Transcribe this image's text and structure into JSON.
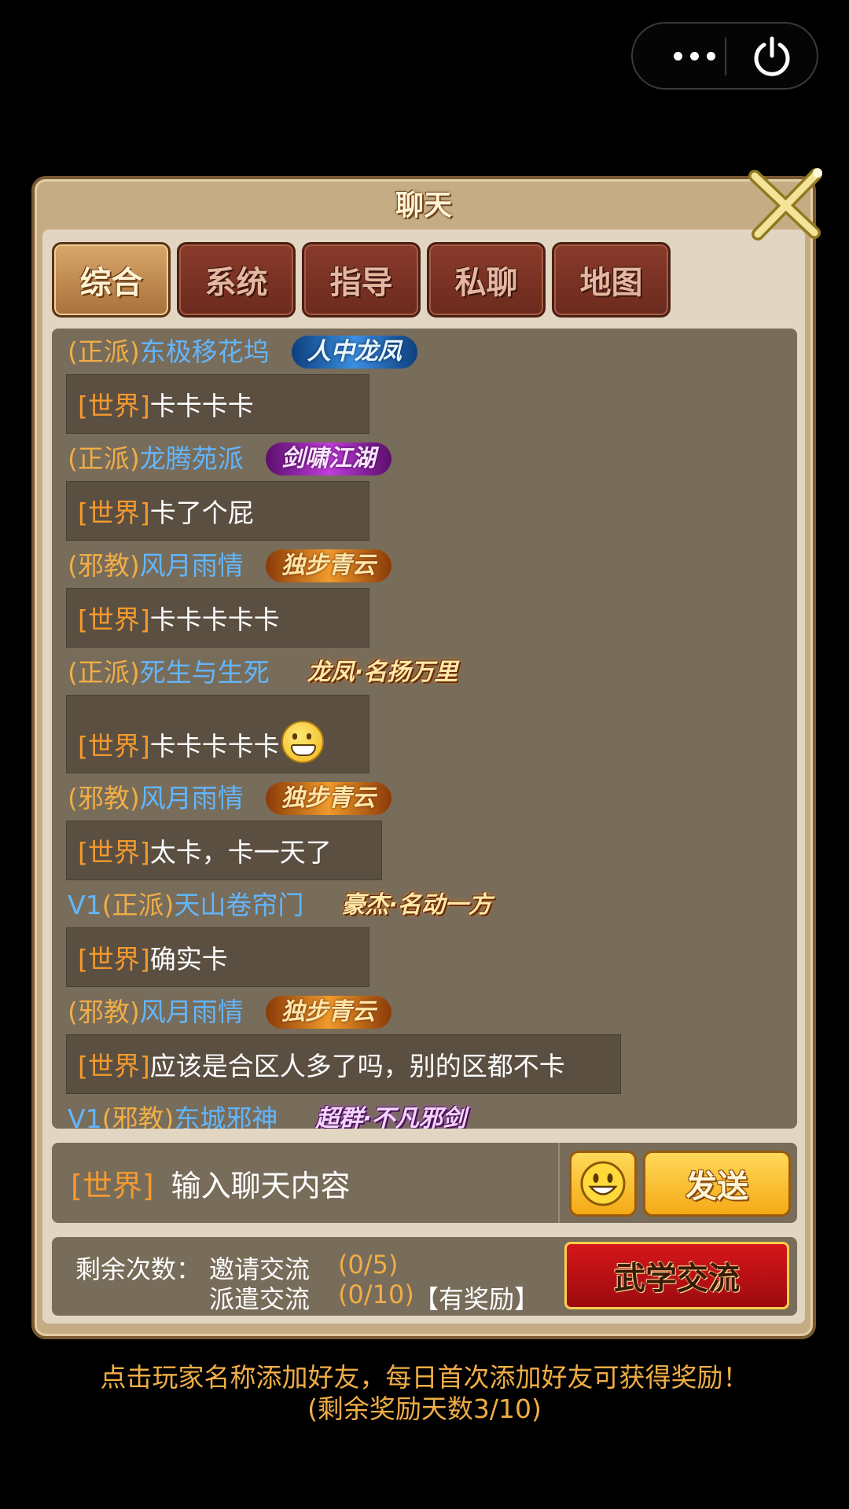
{
  "panel": {
    "title": "聊天"
  },
  "tabs": [
    {
      "label": "综合",
      "active": true
    },
    {
      "label": "系统",
      "active": false
    },
    {
      "label": "指导",
      "active": false
    },
    {
      "label": "私聊",
      "active": false
    },
    {
      "label": "地图",
      "active": false
    }
  ],
  "messages": [
    {
      "prefix": "",
      "sect": "(正派)",
      "name": "东极移花坞",
      "badge": "人中龙凤",
      "channel": "[世界]",
      "text": "卡卡卡卡",
      "emoji": false
    },
    {
      "prefix": "",
      "sect": "(正派)",
      "name": "龙腾苑派",
      "badge": "剑啸江湖",
      "channel": "[世界]",
      "text": "卡了个屁",
      "emoji": false
    },
    {
      "prefix": "",
      "sect": "(邪教)",
      "name": "风月雨情",
      "badge": "独步青云",
      "channel": "[世界]",
      "text": "卡卡卡卡卡",
      "emoji": false
    },
    {
      "prefix": "",
      "sect": "(正派)",
      "name": "死生与生死",
      "badge": "龙凤·名扬万里",
      "channel": "[世界]",
      "text": "卡卡卡卡卡",
      "emoji": true
    },
    {
      "prefix": "",
      "sect": "(邪教)",
      "name": "风月雨情",
      "badge": "独步青云",
      "channel": "[世界]",
      "text": "太卡，卡一天了",
      "emoji": false
    },
    {
      "prefix": "V1",
      "sect": "(正派)",
      "name": "天山卷帘门",
      "badge": "豪杰·名动一方",
      "channel": "[世界]",
      "text": "确实卡",
      "emoji": false
    },
    {
      "prefix": "",
      "sect": "(邪教)",
      "name": "风月雨情",
      "badge": "独步青云",
      "channel": "[世界]",
      "text": "应该是合区人多了吗，别的区都不卡",
      "emoji": false
    },
    {
      "prefix": "V1",
      "sect": "(邪教)",
      "name": "东城邪神",
      "badge": "超群·不凡邪剑"
    }
  ],
  "input": {
    "channel": "[世界]",
    "placeholder": "输入聊天内容",
    "send_label": "发送",
    "emoji_icon": "smiley-icon"
  },
  "exchange": {
    "label": "剩余次数：",
    "invite_label": "邀请交流",
    "invite_count": "(0/5)",
    "dispatch_label": "派遣交流",
    "dispatch_count": "(0/10)",
    "reward": "【有奖励】",
    "button": "武学交流"
  },
  "footer": {
    "line1": "点击玩家名称添加好友，每日首次添加好友可获得奖励！",
    "line2": "(剩余奖励天数3/10)"
  },
  "colors": {
    "sect": "#f0ad46",
    "name": "#62b6ff",
    "channel": "#f59a2e",
    "chat_bg": "#786c5a",
    "bubble_bg": "#5b4f42"
  }
}
